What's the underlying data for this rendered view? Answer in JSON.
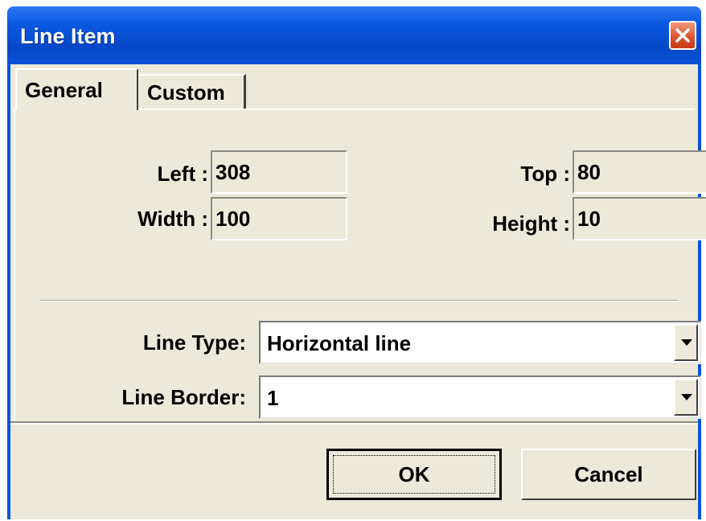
{
  "window": {
    "title": "Line Item",
    "close_icon": "close-icon"
  },
  "tabs": [
    {
      "label": "General",
      "active": true
    },
    {
      "label": "Custom",
      "active": false
    }
  ],
  "position": {
    "left_label": "Left :",
    "left_value": "308",
    "top_label": "Top :",
    "top_value": "80",
    "width_label": "Width :",
    "width_value": "100",
    "height_label": "Height :",
    "height_value": "10"
  },
  "line_type": {
    "label": "Line Type:",
    "value": "Horizontal line"
  },
  "line_border": {
    "label": "Line Border:",
    "value": "1"
  },
  "buttons": {
    "ok": "OK",
    "cancel": "Cancel"
  },
  "colors": {
    "titlebar": "#0a54d8",
    "close": "#d9502c",
    "face": "#ece9d8"
  }
}
